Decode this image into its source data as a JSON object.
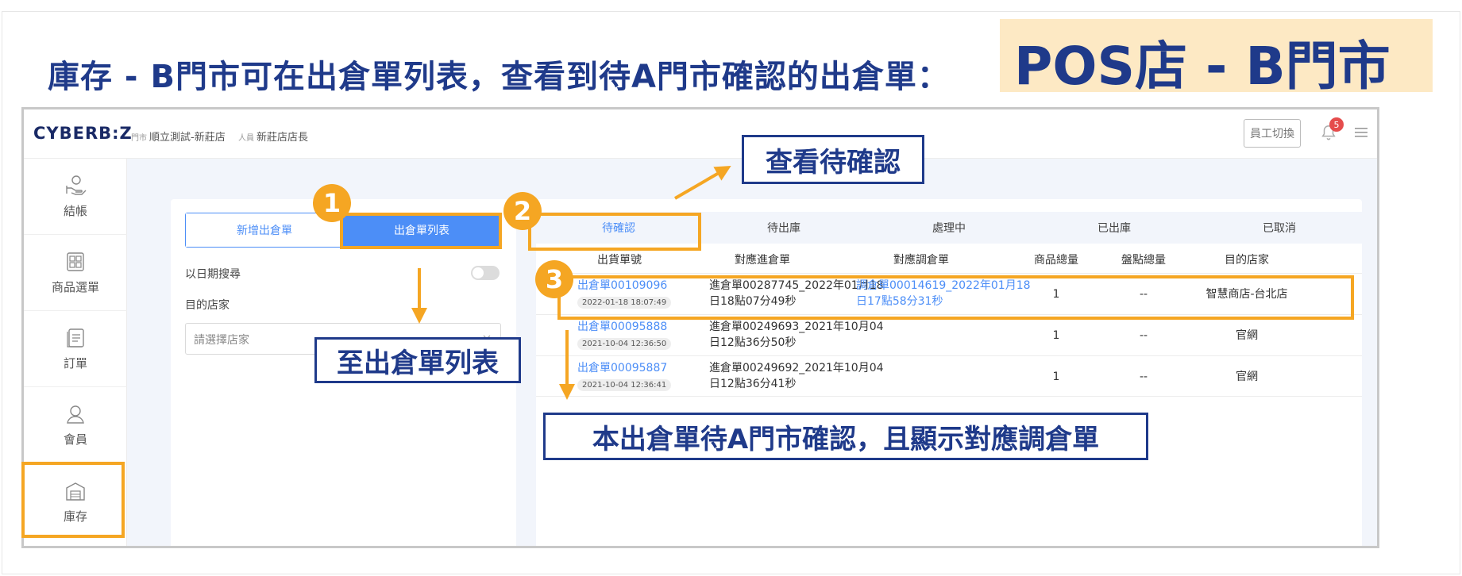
{
  "slide": {
    "heading": "庫存 - B門市可在出倉單列表，查看到待A門市確認的出倉單：",
    "store_tag": "POS店 - B門市"
  },
  "app": {
    "logo": "CYBERB:Z",
    "store_label": "門市",
    "store_value": "順立測試-新莊店",
    "staff_label": "人員",
    "staff_value": "新莊店店長",
    "switch_staff": "員工切換",
    "notification_count": "5"
  },
  "sidebar": {
    "items": [
      {
        "label": "結帳",
        "icon": "cashier-hand-icon"
      },
      {
        "label": "商品選單",
        "icon": "product-grid-icon"
      },
      {
        "label": "訂單",
        "icon": "order-document-icon"
      },
      {
        "label": "會員",
        "icon": "member-user-icon"
      },
      {
        "label": "庫存",
        "icon": "warehouse-icon"
      }
    ]
  },
  "left_panel": {
    "new_outbound": "新增出倉單",
    "outbound_list": "出倉單列表",
    "date_search": "以日期搜尋",
    "target_store": "目的店家",
    "store_placeholder": "請選擇店家"
  },
  "tabs": [
    "待確認",
    "待出庫",
    "處理中",
    "已出庫",
    "已取消"
  ],
  "table": {
    "headers": [
      "出貨單號",
      "對應進倉單",
      "對應調倉單",
      "商品總量",
      "盤點總量",
      "目的店家"
    ],
    "rows": [
      {
        "id": "出倉單00109096",
        "time": "2022-01-18 18:07:49",
        "inbound_1": "進倉單00287745_2022年01月18",
        "inbound_2": "日18點07分49秒",
        "transfer_1": "調倉單00014619_2022年01月18",
        "transfer_2": "日17點58分31秒",
        "qty": "1",
        "count": "--",
        "store": "智慧商店-台北店"
      },
      {
        "id": "出倉單00095888",
        "time": "2021-10-04 12:36:50",
        "inbound_1": "進倉單00249693_2021年10月04",
        "inbound_2": "日12點36分50秒",
        "transfer_1": "",
        "transfer_2": "",
        "qty": "1",
        "count": "--",
        "store": "官網"
      },
      {
        "id": "出倉單00095887",
        "time": "2021-10-04 12:36:41",
        "inbound_1": "進倉單00249692_2021年10月04",
        "inbound_2": "日12點36分41秒",
        "transfer_1": "",
        "transfer_2": "",
        "qty": "1",
        "count": "--",
        "store": "官網"
      }
    ]
  },
  "annotations": {
    "step1": "1",
    "step2": "2",
    "step3": "3",
    "callout_list": "至出倉單列表",
    "callout_pending": "查看待確認",
    "callout_note": "本出倉單待A門市確認，且顯示對應調倉單",
    "highlight_color": "#f5a623",
    "callout_color": "#1f3a8a"
  }
}
